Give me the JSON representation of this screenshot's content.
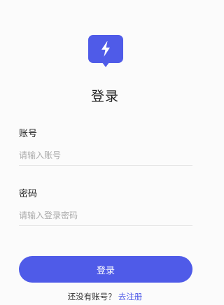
{
  "logo": {
    "icon": "lightning-bolt-icon",
    "color": "#4f5be8"
  },
  "title": "登录",
  "account": {
    "label": "账号",
    "placeholder": "请输入账号"
  },
  "password": {
    "label": "密码",
    "placeholder": "请输入登录密码"
  },
  "login_button": {
    "label": "登录",
    "color": "#4f5be8"
  },
  "footer": {
    "prompt": "还没有账号？",
    "register_link": "去注册"
  }
}
